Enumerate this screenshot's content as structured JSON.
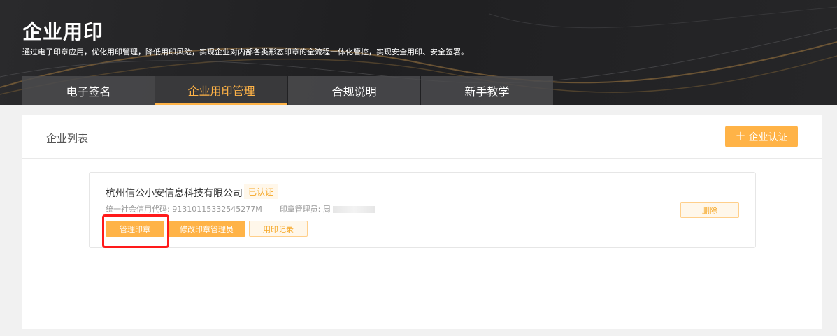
{
  "banner": {
    "title": "企业用印",
    "subtitle": "通过电子印章应用，优化用印管理，降低用印风险，实现企业对内部各类形态印章的全流程一体化管控，实现安全用印、安全签署。"
  },
  "tabs": [
    {
      "label": "电子签名",
      "active": false
    },
    {
      "label": "企业用印管理",
      "active": true
    },
    {
      "label": "合规说明",
      "active": false
    },
    {
      "label": "新手教学",
      "active": false
    }
  ],
  "panel": {
    "title": "企业列表",
    "certify_button": "企业认证",
    "certify_icon": "plus-icon"
  },
  "company": {
    "name": "杭州信公小安信息科技有限公司",
    "status": "已认证",
    "credit_code_label": "统一社会信用代码:",
    "credit_code": "91310115332545277M",
    "seal_admin_label": "印章管理员:",
    "seal_admin": "周",
    "actions": {
      "manage": "管理印章",
      "edit_admin": "修改印章管理员",
      "records": "用印记录",
      "delete": "删除"
    }
  },
  "colors": {
    "accent": "#ffb347",
    "accent_text": "#f5a623",
    "highlight": "#ff1a1a"
  }
}
